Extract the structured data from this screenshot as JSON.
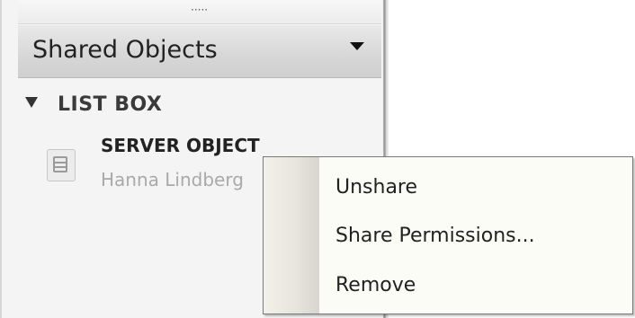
{
  "panel": {
    "grip": "·····",
    "title": "Shared Objects",
    "dropdown_icon": "triangle-down"
  },
  "group": {
    "label": "LIST BOX",
    "expanded": true
  },
  "items": [
    {
      "title": "SERVER OBJECT",
      "owner": "Hanna Lindberg",
      "icon": "list-box-icon"
    }
  ],
  "context_menu": {
    "items": [
      {
        "label": "Unshare"
      },
      {
        "label": "Share Permissions..."
      },
      {
        "label": "Remove"
      }
    ]
  }
}
